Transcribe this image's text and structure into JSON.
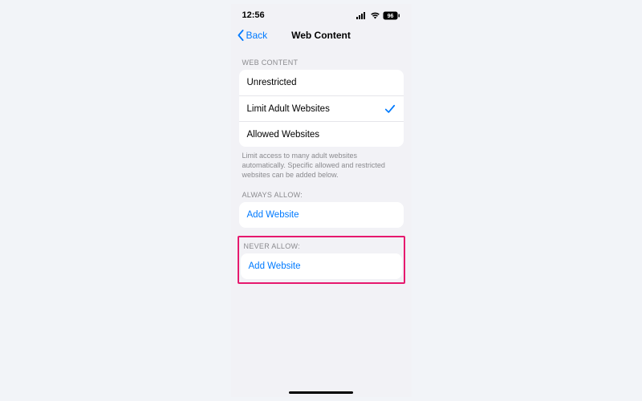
{
  "status": {
    "time": "12:56",
    "battery": "96"
  },
  "nav": {
    "back": "Back",
    "title": "Web Content"
  },
  "sections": {
    "webContent": {
      "header": "WEB CONTENT",
      "options": {
        "unrestricted": "Unrestricted",
        "limitAdult": "Limit Adult Websites",
        "allowedOnly": "Allowed Websites"
      },
      "footer": "Limit access to many adult websites automatically. Specific allowed and restricted websites can be added below."
    },
    "alwaysAllow": {
      "header": "ALWAYS ALLOW:",
      "addLabel": "Add Website"
    },
    "neverAllow": {
      "header": "NEVER ALLOW:",
      "addLabel": "Add Website"
    }
  }
}
